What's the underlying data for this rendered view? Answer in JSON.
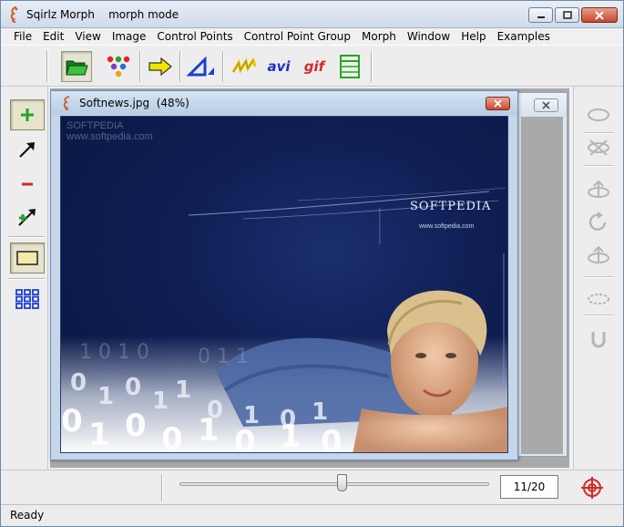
{
  "window": {
    "app_name": "Sqirlz Morph",
    "mode": "morph mode"
  },
  "menu": [
    "File",
    "Edit",
    "View",
    "Image",
    "Control Points",
    "Control Point Group",
    "Morph",
    "Window",
    "Help",
    "Examples"
  ],
  "toolbar": {
    "buttons": [
      {
        "name": "open-folder-icon"
      },
      {
        "name": "color-dots-icon"
      },
      {
        "name": "arrow-right-icon"
      },
      {
        "name": "triangle-ruler-icon"
      },
      {
        "name": "wave-icon"
      },
      {
        "name": "avi-icon",
        "label": "avi"
      },
      {
        "name": "gif-icon",
        "label": "gif"
      },
      {
        "name": "frames-icon"
      }
    ]
  },
  "left_tools": [
    "add-point-icon",
    "move-arrow-icon",
    "remove-point-icon",
    "link-points-icon",
    "rectangle-select-icon",
    "grid-icon"
  ],
  "right_tools": [
    "ellipse-icon",
    "delete-group-icon",
    "move-up-icon",
    "rotate-icon",
    "flip-icon",
    "scale-icon",
    "magnet-icon"
  ],
  "document": {
    "title": "Softnews.jpg  (48%)",
    "watermark": "SOFTPEDIA\nwww.softpedia.com",
    "logo_text": "SOFTPEDIA",
    "logo_url": "www.softpedia.com"
  },
  "slider": {
    "value": 11,
    "total": 20,
    "readout": "11/20"
  },
  "status": {
    "text": "Ready"
  },
  "colors": {
    "accent_green": "#2aa12a",
    "accent_red": "#d42a2a",
    "accent_blue": "#1c3fd1",
    "canvas_bg": "#0f1f55"
  }
}
